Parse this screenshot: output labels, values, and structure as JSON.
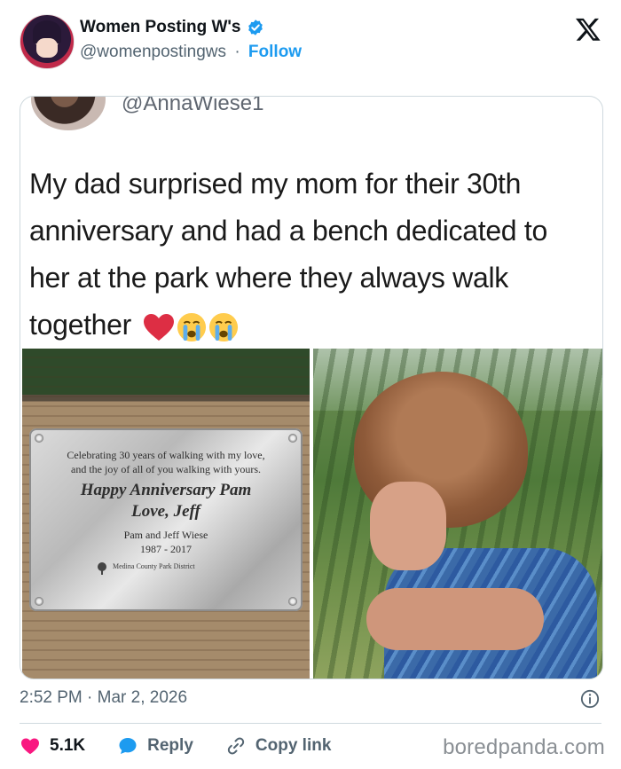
{
  "header": {
    "display_name": "Women Posting W's",
    "handle": "@womenpostingws",
    "separator": "·",
    "follow_label": "Follow"
  },
  "embedded": {
    "handle": "@AnnaWiese1",
    "text": "My dad surprised my mom for their 30th anniversary and had a bench dedicated to her at the park where they always walk together",
    "plaque": {
      "line1": "Celebrating 30 years of walking with my love,",
      "line2": "and the joy of all of you walking with yours.",
      "line3": "Happy Anniversary Pam",
      "line4": "Love, Jeff",
      "line5": "Pam and Jeff Wiese",
      "line6": "1987 - 2017",
      "line7": "Medina County Park District"
    }
  },
  "timestamp": "2:52 PM · Mar 2, 2026",
  "actions": {
    "likes": "5.1K",
    "reply_label": "Reply",
    "copy_label": "Copy link"
  },
  "watermark": "boredpanda.com",
  "colors": {
    "accent": "#1d9bf0",
    "like": "#f91880",
    "muted": "#536471"
  }
}
